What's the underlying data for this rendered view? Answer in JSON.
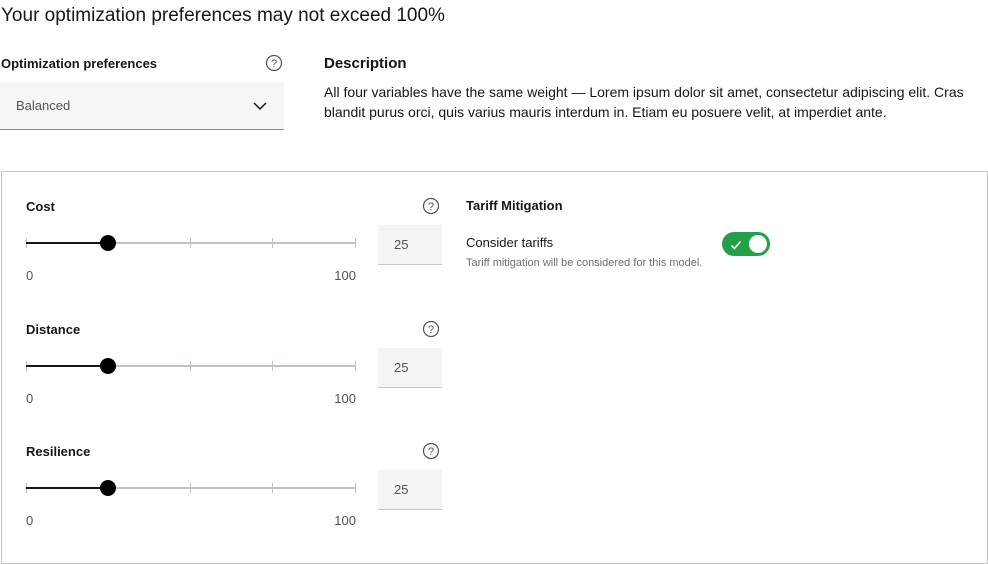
{
  "warning": "Your optimization preferences may not exceed 100%",
  "preferences": {
    "label": "Optimization preferences",
    "help_icon": "help-circle-icon",
    "selected": "Balanced",
    "chevron_icon": "chevron-down-icon"
  },
  "description": {
    "title": "Description",
    "text": "All four variables have the same weight — Lorem ipsum dolor sit amet, consectetur adipiscing elit. Cras blandit purus orci, quis varius mauris interdum in. Etiam eu posuere velit, at imperdiet ante."
  },
  "sliders": [
    {
      "label": "Cost",
      "min": "0",
      "max": "100",
      "value": "25"
    },
    {
      "label": "Distance",
      "min": "0",
      "max": "100",
      "value": "25"
    },
    {
      "label": "Resilience",
      "min": "0",
      "max": "100",
      "value": "25"
    }
  ],
  "tariff": {
    "title": "Tariff Mitigation",
    "toggle_label": "Consider tariffs",
    "helper": "Tariff mitigation will be considered for this model.",
    "toggle_on": true
  },
  "colors": {
    "toggle_on": "#24a148",
    "slider_fill": "#161616",
    "slider_track": "#c6c2bb"
  }
}
